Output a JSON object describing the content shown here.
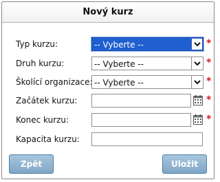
{
  "dialog": {
    "title": "Nový kurz"
  },
  "fields": {
    "course_type": {
      "label": "Typ kurzu:",
      "value": "-- Vyberte --"
    },
    "course_kind": {
      "label": "Druh kurzu:",
      "value": "-- Vyberte --"
    },
    "training_org": {
      "label": "Školící organizace:",
      "value": "-- Vyberte --"
    },
    "start_date": {
      "label": "Začátek kurzu:",
      "value": ""
    },
    "end_date": {
      "label": "Konec kurzu:",
      "value": ""
    },
    "capacity": {
      "label": "Kapacita kurzu:",
      "value": ""
    }
  },
  "required_marker": "*",
  "buttons": {
    "back": "Zpět",
    "save": "Uložit"
  },
  "colors": {
    "accent": "#1f5fd0",
    "required": "#d21c1c",
    "button": "#7fa6c6"
  }
}
